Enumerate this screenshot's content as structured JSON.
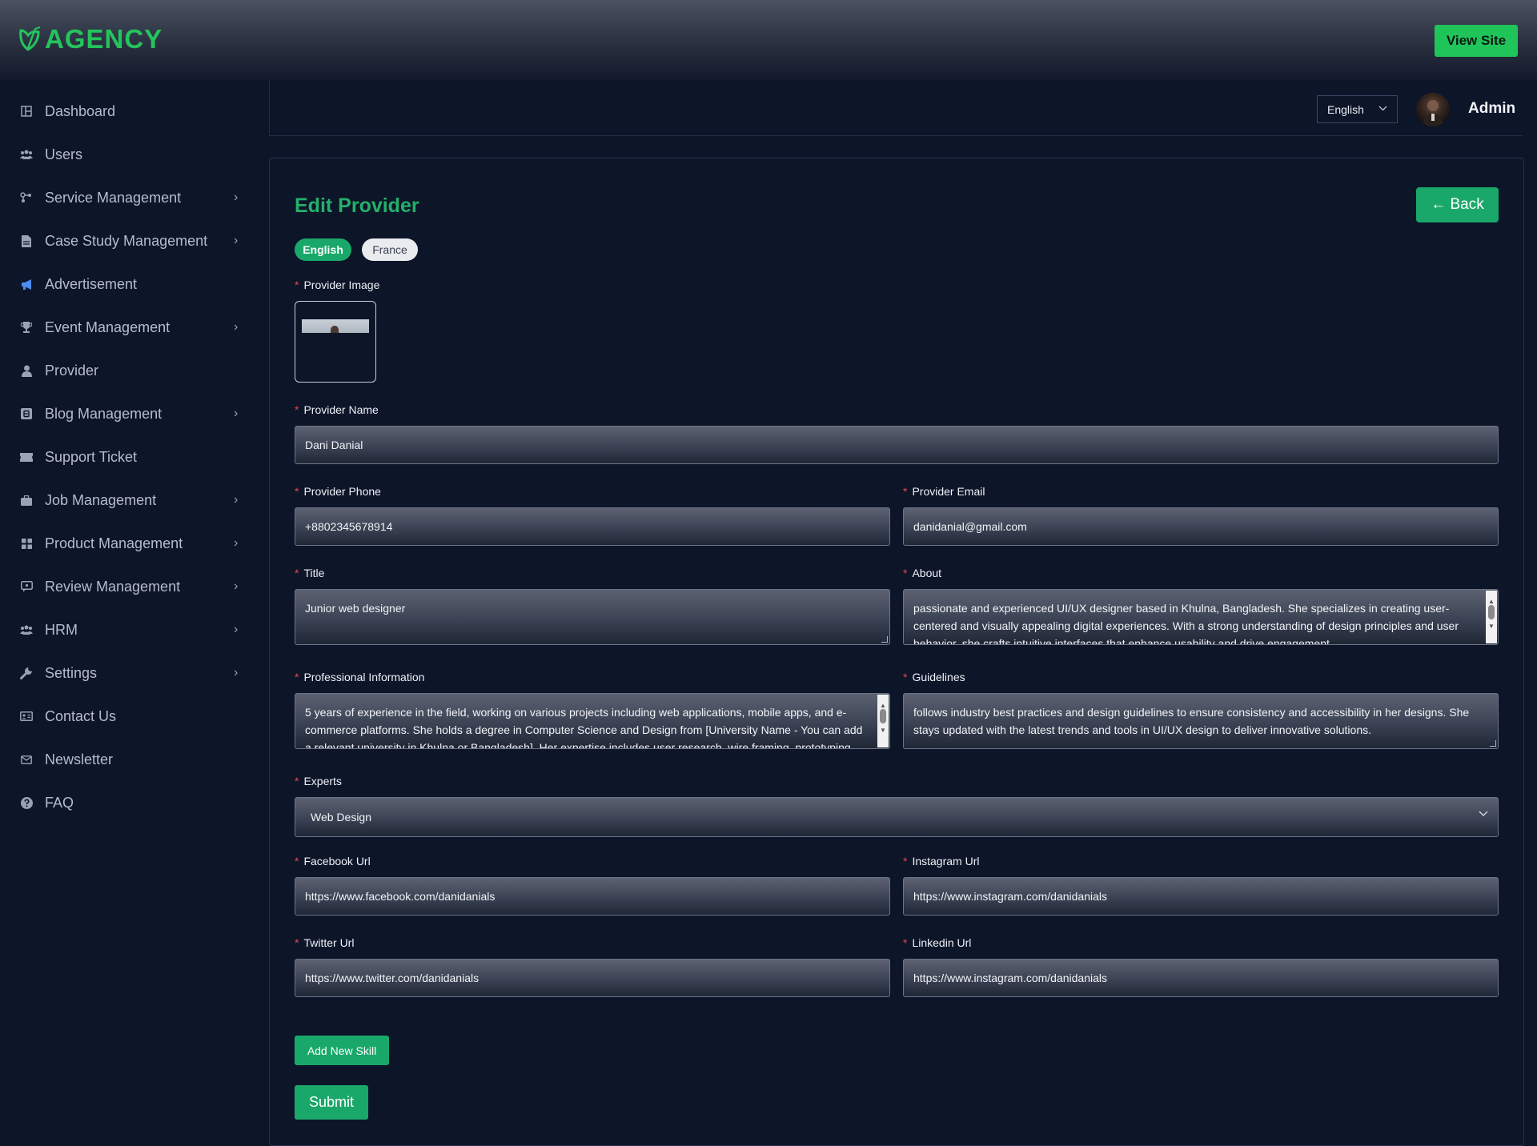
{
  "brand": {
    "name": "AGENCY",
    "color": "#24c45c"
  },
  "topbar": {
    "view_site_label": "View Site"
  },
  "sidebar": {
    "items": [
      {
        "label": "Dashboard",
        "icon": "dashboard-icon",
        "has_submenu": false
      },
      {
        "label": "Users",
        "icon": "users-icon",
        "has_submenu": false
      },
      {
        "label": "Service Management",
        "icon": "service-icon",
        "has_submenu": true
      },
      {
        "label": "Case Study Management",
        "icon": "document-icon",
        "has_submenu": true
      },
      {
        "label": "Advertisement",
        "icon": "megaphone-icon",
        "has_submenu": false
      },
      {
        "label": "Event Management",
        "icon": "trophy-icon",
        "has_submenu": true
      },
      {
        "label": "Provider",
        "icon": "person-icon",
        "has_submenu": false
      },
      {
        "label": "Blog Management",
        "icon": "blog-icon",
        "has_submenu": true
      },
      {
        "label": "Support Ticket",
        "icon": "ticket-icon",
        "has_submenu": false
      },
      {
        "label": "Job Management",
        "icon": "briefcase-icon",
        "has_submenu": true
      },
      {
        "label": "Product Management",
        "icon": "grid-icon",
        "has_submenu": true
      },
      {
        "label": "Review Management",
        "icon": "review-icon",
        "has_submenu": true
      },
      {
        "label": "HRM",
        "icon": "team-icon",
        "has_submenu": true
      },
      {
        "label": "Settings",
        "icon": "wrench-icon",
        "has_submenu": true
      },
      {
        "label": "Contact Us",
        "icon": "contact-card-icon",
        "has_submenu": false
      },
      {
        "label": "Newsletter",
        "icon": "mail-icon",
        "has_submenu": false
      },
      {
        "label": "FAQ",
        "icon": "question-icon",
        "has_submenu": false
      }
    ]
  },
  "header": {
    "language": "English",
    "user_name": "Admin"
  },
  "form": {
    "title": "Edit Provider",
    "back_label": "← Back",
    "languages": [
      "English",
      "France"
    ],
    "active_language": "English",
    "image_label": "Provider Image",
    "name_label": "Provider Name",
    "name_value": "Dani Danial",
    "phone_label": "Provider Phone",
    "phone_value": "+8802345678914",
    "email_label": "Provider Email",
    "email_value": "danidanial@gmail.com",
    "title_label": "Title",
    "title_value": "Junior web designer",
    "about_label": "About",
    "about_value": "passionate and experienced UI/UX designer based in Khulna, Bangladesh. She specializes in creating user-centered and visually appealing digital experiences. With a strong understanding of design principles and user behavior, she crafts intuitive interfaces that enhance usability and drive engagement.",
    "professional_label": "Professional Information",
    "professional_value": "5 years of experience in the field, working on various projects including web applications, mobile apps, and e-commerce platforms. She holds a degree in Computer Science and Design from [University Name - You can add a relevant university in Khulna or Bangladesh]. Her expertise includes user research, wire framing, prototyping, and",
    "guidelines_label": "Guidelines",
    "guidelines_value": "follows industry best practices and design guidelines to ensure consistency and accessibility in her designs. She stays updated with the latest trends and tools in UI/UX design to deliver innovative solutions.",
    "experts_label": "Experts",
    "experts_value": "Web Design",
    "facebook_label": "Facebook Url",
    "facebook_value": "https://www.facebook.com/danidanials",
    "instagram_label": "Instagram Url",
    "instagram_value": "https://www.instagram.com/danidanials",
    "twitter_label": "Twitter Url",
    "twitter_value": "https://www.twitter.com/danidanials",
    "linkedin_label": "Linkedin Url",
    "linkedin_value": "https://www.instagram.com/danidanials",
    "add_skill_label": "Add New Skill",
    "submit_label": "Submit"
  },
  "colors": {
    "accent": "#1aa86a",
    "required": "#e5484d",
    "background": "#0d1529"
  }
}
